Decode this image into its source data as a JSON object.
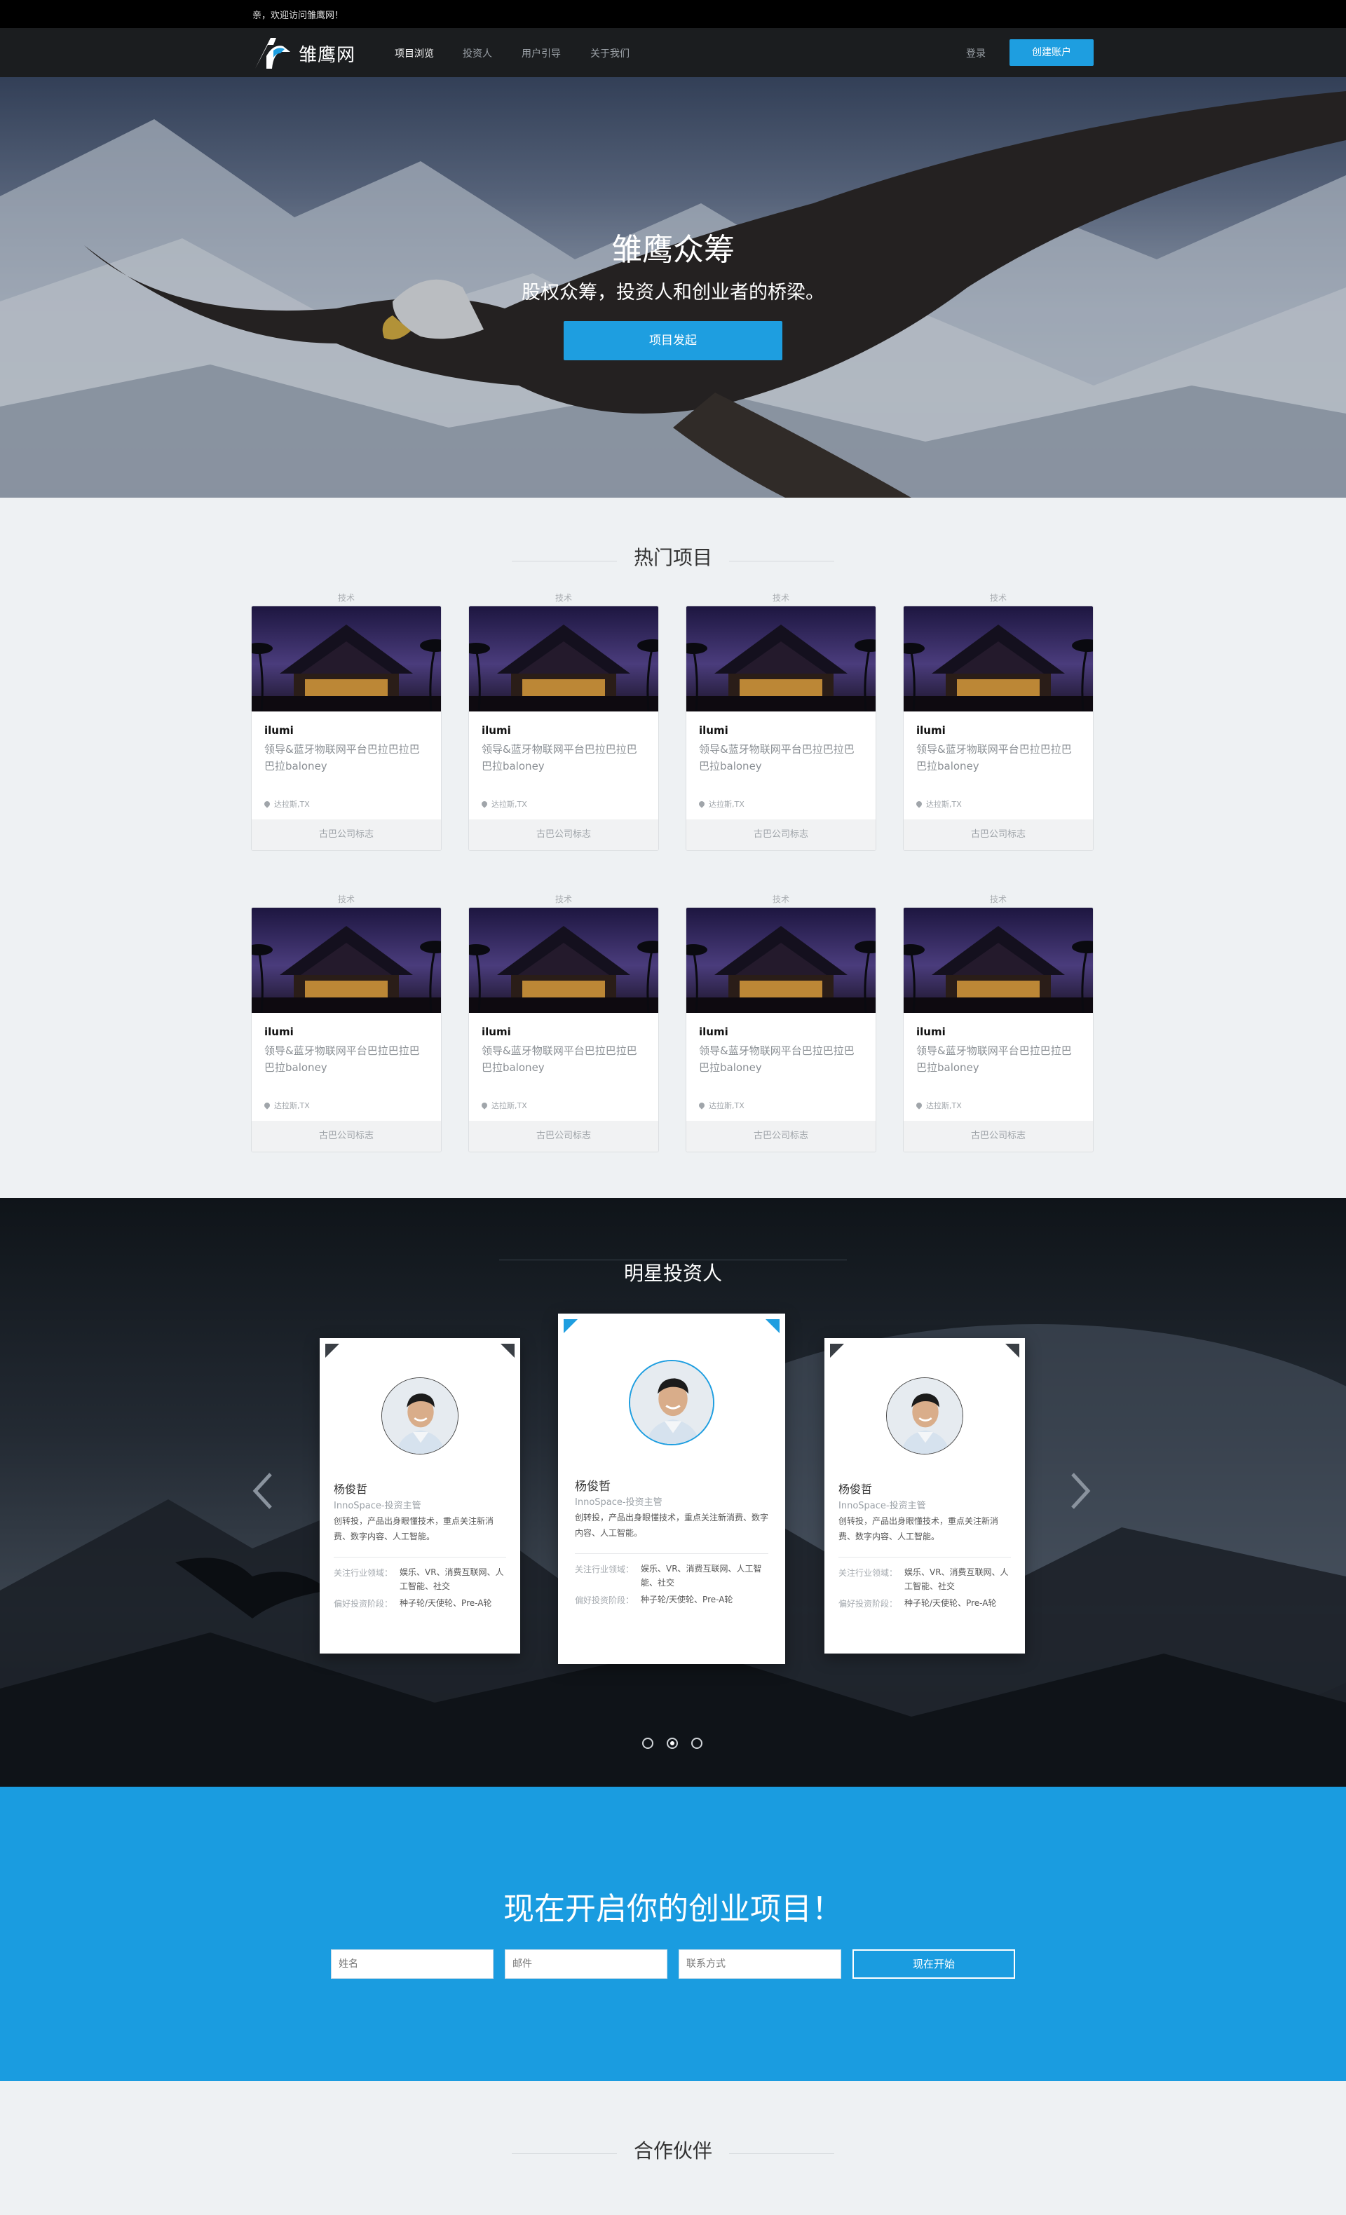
{
  "topbar": {
    "welcome": "亲，欢迎访问雏鹰网！"
  },
  "nav": {
    "logo_text": "雏鹰网",
    "items": [
      "项目浏览",
      "投资人",
      "用户引导",
      "关于我们"
    ],
    "login": "登录",
    "create_account": "创建账户"
  },
  "hero": {
    "title": "雏鹰众筹",
    "subtitle": "股权众筹，投资人和创业者的桥梁。",
    "button": "项目发起"
  },
  "projects": {
    "title": "热门项目",
    "cards": [
      {
        "category": "技术",
        "name": "ilumi",
        "desc": "领导&蓝牙物联网平台巴拉巴拉巴巴拉baloney",
        "location": "达拉斯,TX",
        "footer": "古巴公司标志"
      },
      {
        "category": "技术",
        "name": "ilumi",
        "desc": "领导&蓝牙物联网平台巴拉巴拉巴巴拉baloney",
        "location": "达拉斯,TX",
        "footer": "古巴公司标志"
      },
      {
        "category": "技术",
        "name": "ilumi",
        "desc": "领导&蓝牙物联网平台巴拉巴拉巴巴拉baloney",
        "location": "达拉斯,TX",
        "footer": "古巴公司标志"
      },
      {
        "category": "技术",
        "name": "ilumi",
        "desc": "领导&蓝牙物联网平台巴拉巴拉巴巴拉baloney",
        "location": "达拉斯,TX",
        "footer": "古巴公司标志"
      },
      {
        "category": "技术",
        "name": "ilumi",
        "desc": "领导&蓝牙物联网平台巴拉巴拉巴巴拉baloney",
        "location": "达拉斯,TX",
        "footer": "古巴公司标志"
      },
      {
        "category": "技术",
        "name": "ilumi",
        "desc": "领导&蓝牙物联网平台巴拉巴拉巴巴拉baloney",
        "location": "达拉斯,TX",
        "footer": "古巴公司标志"
      },
      {
        "category": "技术",
        "name": "ilumi",
        "desc": "领导&蓝牙物联网平台巴拉巴拉巴巴拉baloney",
        "location": "达拉斯,TX",
        "footer": "古巴公司标志"
      },
      {
        "category": "技术",
        "name": "ilumi",
        "desc": "领导&蓝牙物联网平台巴拉巴拉巴巴拉baloney",
        "location": "达拉斯,TX",
        "footer": "古巴公司标志"
      }
    ]
  },
  "investors": {
    "title": "明星投资人",
    "cards": [
      {
        "name": "杨俊哲",
        "role": "InnoSpace-投资主管",
        "bio": "创转投，产品出身眼懂技术，重点关注新消费、数字内容、人工智能。",
        "focus_label": "关注行业领域：",
        "focus": "娱乐、VR、消费互联网、人工智能、社交",
        "stage_label": "偏好投资阶段：",
        "stage": "种子轮/天使轮、Pre-A轮"
      },
      {
        "name": "杨俊哲",
        "role": "InnoSpace-投资主管",
        "bio": "创转投，产品出身眼懂技术，重点关注新消费、数字内容、人工智能。",
        "focus_label": "关注行业领域：",
        "focus": "娱乐、VR、消费互联网、人工智能、社交",
        "stage_label": "偏好投资阶段：",
        "stage": "种子轮/天使轮、Pre-A轮"
      },
      {
        "name": "杨俊哲",
        "role": "InnoSpace-投资主管",
        "bio": "创转投，产品出身眼懂技术，重点关注新消费、数字内容、人工智能。",
        "focus_label": "关注行业领域：",
        "focus": "娱乐、VR、消费互联网、人工智能、社交",
        "stage_label": "偏好投资阶段：",
        "stage": "种子轮/天使轮、Pre-A轮"
      }
    ],
    "active_slide": 2
  },
  "cta": {
    "title": "现在开启你的创业项目！",
    "name_placeholder": "姓名",
    "email_placeholder": "邮件",
    "contact_placeholder": "联系方式",
    "button": "现在开始"
  },
  "partners": {
    "title": "合作伙伴"
  },
  "colors": {
    "accent": "#1e9ee0",
    "nav_bg": "#1b1d1f",
    "page_bg": "#eef1f3"
  },
  "icons": [
    "logo-mark-icon",
    "location-pin-icon",
    "chevron-left-icon",
    "chevron-right-icon"
  ]
}
